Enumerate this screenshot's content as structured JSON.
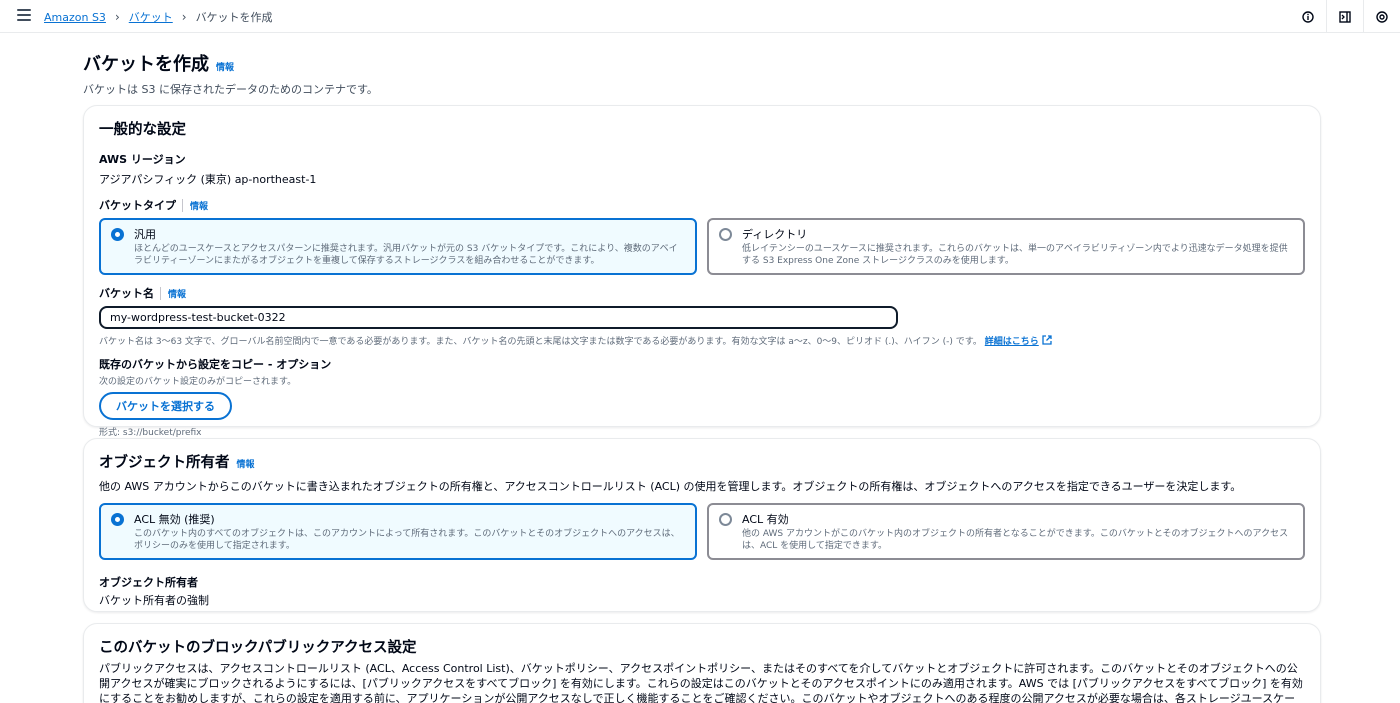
{
  "breadcrumb": {
    "root": "Amazon S3",
    "buckets": "バケット",
    "current": "バケットを作成"
  },
  "page": {
    "title": "バケットを作成",
    "info": "情報",
    "description": "バケットは S3 に保存されたデータのためのコンテナです。"
  },
  "general": {
    "title": "一般的な設定",
    "region_label": "AWS リージョン",
    "region_value": "アジアパシフィック (東京) ap-northeast-1",
    "bucket_type_label": "バケットタイプ",
    "bucket_type_info": "情報",
    "types": [
      {
        "title": "汎用",
        "desc": "ほとんどのユースケースとアクセスパターンに推奨されます。汎用バケットが元の S3 バケットタイプです。これにより、複数のアベイラビリティーゾーンにまたがるオブジェクトを重複して保存するストレージクラスを組み合わせることができます。",
        "selected": true
      },
      {
        "title": "ディレクトリ",
        "desc": "低レイテンシーのユースケースに推奨されます。これらのバケットは、単一のアベイラビリティゾーン内でより迅速なデータ処理を提供する S3 Express One Zone ストレージクラスのみを使用します。",
        "selected": false
      }
    ],
    "bucket_name_label": "バケット名",
    "bucket_name_info": "情報",
    "bucket_name_value": "my-wordpress-test-bucket-0322",
    "bucket_name_hint": "バケット名は 3～63 文字で、グローバル名前空間内で一意である必要があります。また、バケット名の先頭と末尾は文字または数字である必要があります。有効な文字は a～z、0～9、ピリオド (.)、ハイフン (-) です。",
    "bucket_name_link": "詳細はこちら",
    "copy_label": "既存のバケットから設定をコピー - オプション",
    "copy_hint": "次の設定のバケット設定のみがコピーされます。",
    "choose_button": "バケットを選択する",
    "format_hint": "形式: s3://bucket/prefix"
  },
  "ownership": {
    "title": "オブジェクト所有者",
    "info": "情報",
    "description": "他の AWS アカウントからこのバケットに書き込まれたオブジェクトの所有権と、アクセスコントロールリスト (ACL) の使用を管理します。オブジェクトの所有権は、オブジェクトへのアクセスを指定できるユーザーを決定します。",
    "options": [
      {
        "title": "ACL 無効 (推奨)",
        "desc": "このバケット内のすべてのオブジェクトは、このアカウントによって所有されます。このバケットとそのオブジェクトへのアクセスは、ポリシーのみを使用して指定されます。",
        "selected": true
      },
      {
        "title": "ACL 有効",
        "desc": "他の AWS アカウントがこのバケット内のオブジェクトの所有者となることができます。このバケットとそのオブジェクトへのアクセスは、ACL を使用して指定できます。",
        "selected": false
      }
    ],
    "owner_label": "オブジェクト所有者",
    "owner_value": "バケット所有者の強制"
  },
  "block_public": {
    "title": "このバケットのブロックパブリックアクセス設定",
    "description": "パブリックアクセスは、アクセスコントロールリスト (ACL、Access Control List)、バケットポリシー、アクセスポイントポリシー、またはそのすべてを介してバケットとオブジェクトに許可されます。このバケットとそのオブジェクトへの公開アクセスが確実にブロックされるようにするには、[パブリックアクセスをすべてブロック] を有効にします。これらの設定はこのバケットとそのアクセスポイントにのみ適用されます。AWS では [パブリックアクセスをすべてブロック] を有効にすることをお勧めしますが、これらの設定を適用する前に、アプリケーションが公開アクセスなしで正しく機能することをご確認ください。このバケットやオブジェクトへのある程度の公開アクセスが必要な場合は、各ストレージユースケースに合わせて以下にある"
  }
}
